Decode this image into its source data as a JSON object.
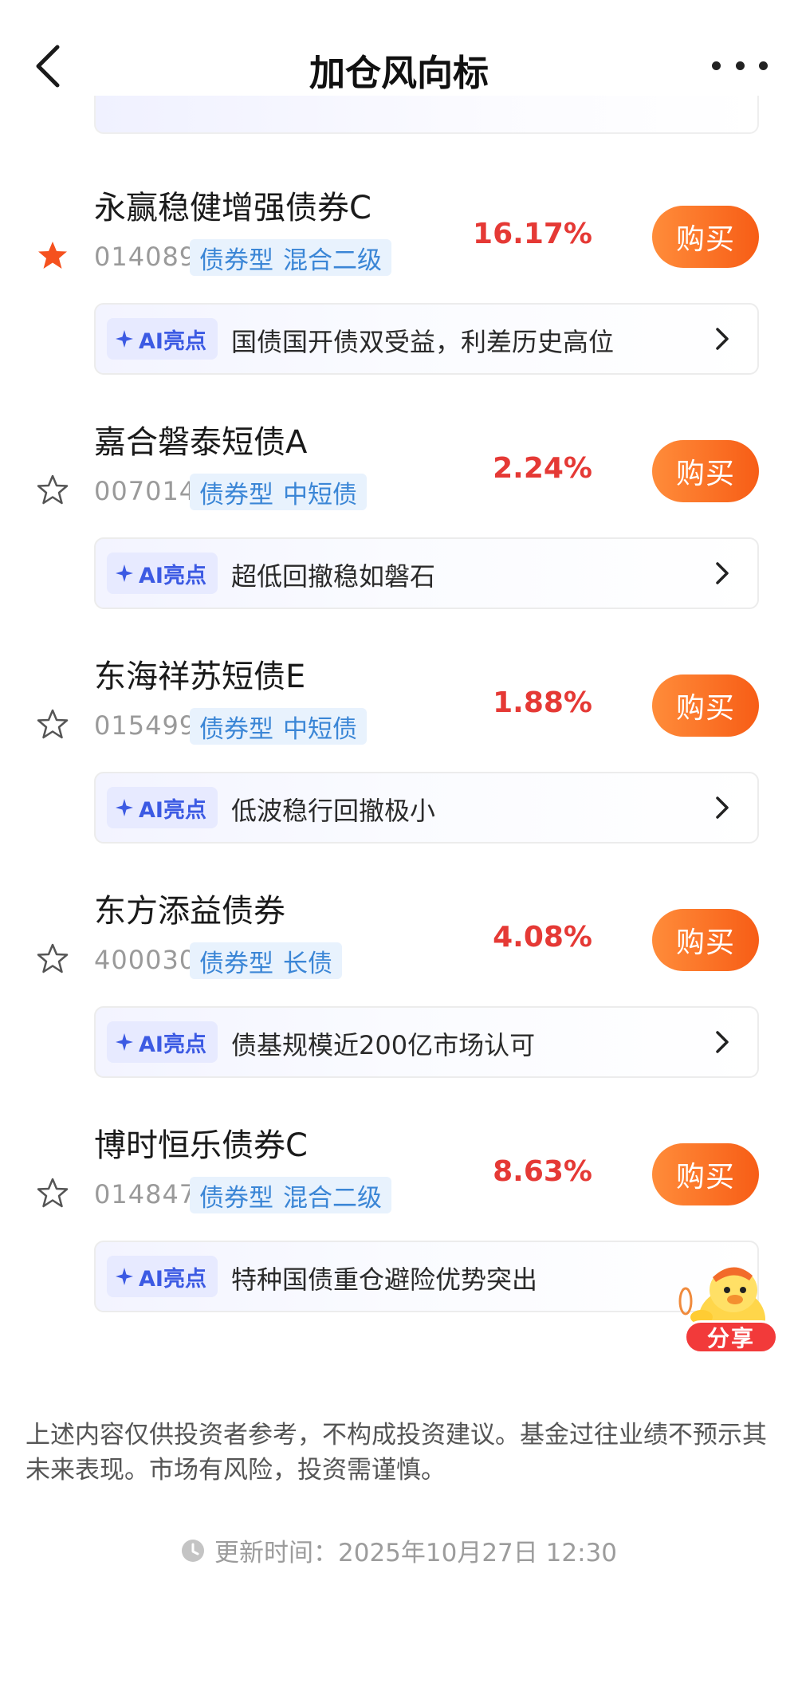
{
  "header": {
    "title": "加仓风向标",
    "back_icon": "chevron-left-icon",
    "more_icon": "more-dots-icon"
  },
  "colors": {
    "rate_red": "#e53935",
    "buy_orange": "#f75d16",
    "tag_blue": "#3b86d6",
    "ai_purple": "#3c5ae3",
    "star_active": "#f5511e"
  },
  "funds": [
    {
      "name": "永赢稳健增强债券C",
      "code": "014089",
      "tags": [
        "债券型",
        "混合二级"
      ],
      "rate": "16.17%",
      "buy_label": "购买",
      "ai_label": "AI亮点",
      "ai_text": "国债国开债双受益，利差历史高位",
      "starred": true
    },
    {
      "name": "嘉合磐泰短债A",
      "code": "007014",
      "tags": [
        "债券型",
        "中短债"
      ],
      "rate": "2.24%",
      "buy_label": "购买",
      "ai_label": "AI亮点",
      "ai_text": "超低回撤稳如磐石",
      "starred": false
    },
    {
      "name": "东海祥苏短债E",
      "code": "015499",
      "tags": [
        "债券型",
        "中短债"
      ],
      "rate": "1.88%",
      "buy_label": "购买",
      "ai_label": "AI亮点",
      "ai_text": "低波稳行回撤极小",
      "starred": false
    },
    {
      "name": "东方添益债券",
      "code": "400030",
      "tags": [
        "债券型",
        "长债"
      ],
      "rate": "4.08%",
      "buy_label": "购买",
      "ai_label": "AI亮点",
      "ai_text": "债基规模近200亿市场认可",
      "starred": false
    },
    {
      "name": "博时恒乐债券C",
      "code": "014847",
      "tags": [
        "债券型",
        "混合二级"
      ],
      "rate": "8.63%",
      "buy_label": "购买",
      "ai_label": "AI亮点",
      "ai_text": "特种国债重仓避险优势突出",
      "starred": false
    }
  ],
  "share": {
    "label": "分享"
  },
  "disclaimer": "上述内容仅供投资者参考，不构成投资建议。基金过往业绩不预示其未来表现。市场有风险，投资需谨慎。",
  "update": {
    "label": "更新时间：",
    "time": "2025年10月27日 12:30"
  }
}
